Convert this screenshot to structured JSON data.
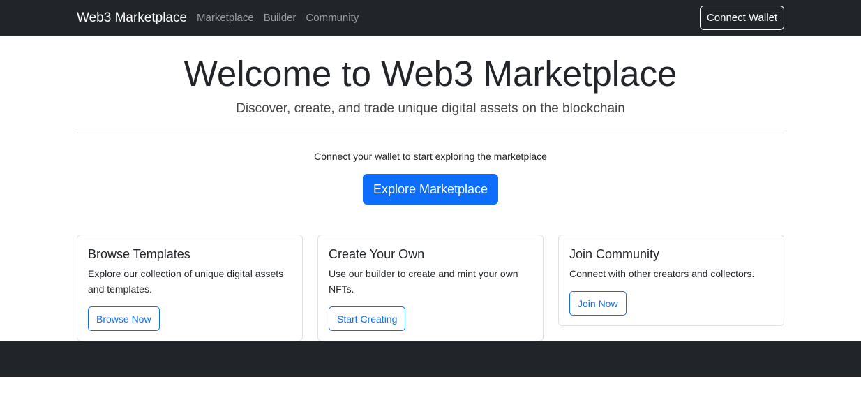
{
  "navbar": {
    "brand": "Web3 Marketplace",
    "links": [
      "Marketplace",
      "Builder",
      "Community"
    ],
    "connect_wallet": "Connect Wallet"
  },
  "hero": {
    "title": "Welcome to Web3 Marketplace",
    "subtitle": "Discover, create, and trade unique digital assets on the blockchain",
    "connect_prompt": "Connect your wallet to start exploring the marketplace",
    "explore_button": "Explore Marketplace"
  },
  "cards": [
    {
      "title": "Browse Templates",
      "text": "Explore our collection of unique digital assets and templates.",
      "button": "Browse Now"
    },
    {
      "title": "Create Your Own",
      "text": "Use our builder to create and mint your own NFTs.",
      "button": "Start Creating"
    },
    {
      "title": "Join Community",
      "text": "Connect with other creators and collectors.",
      "button": "Join Now"
    }
  ],
  "colors": {
    "navbar_bg": "#212529",
    "primary": "#0d6efd",
    "footer_bg": "#212529"
  }
}
